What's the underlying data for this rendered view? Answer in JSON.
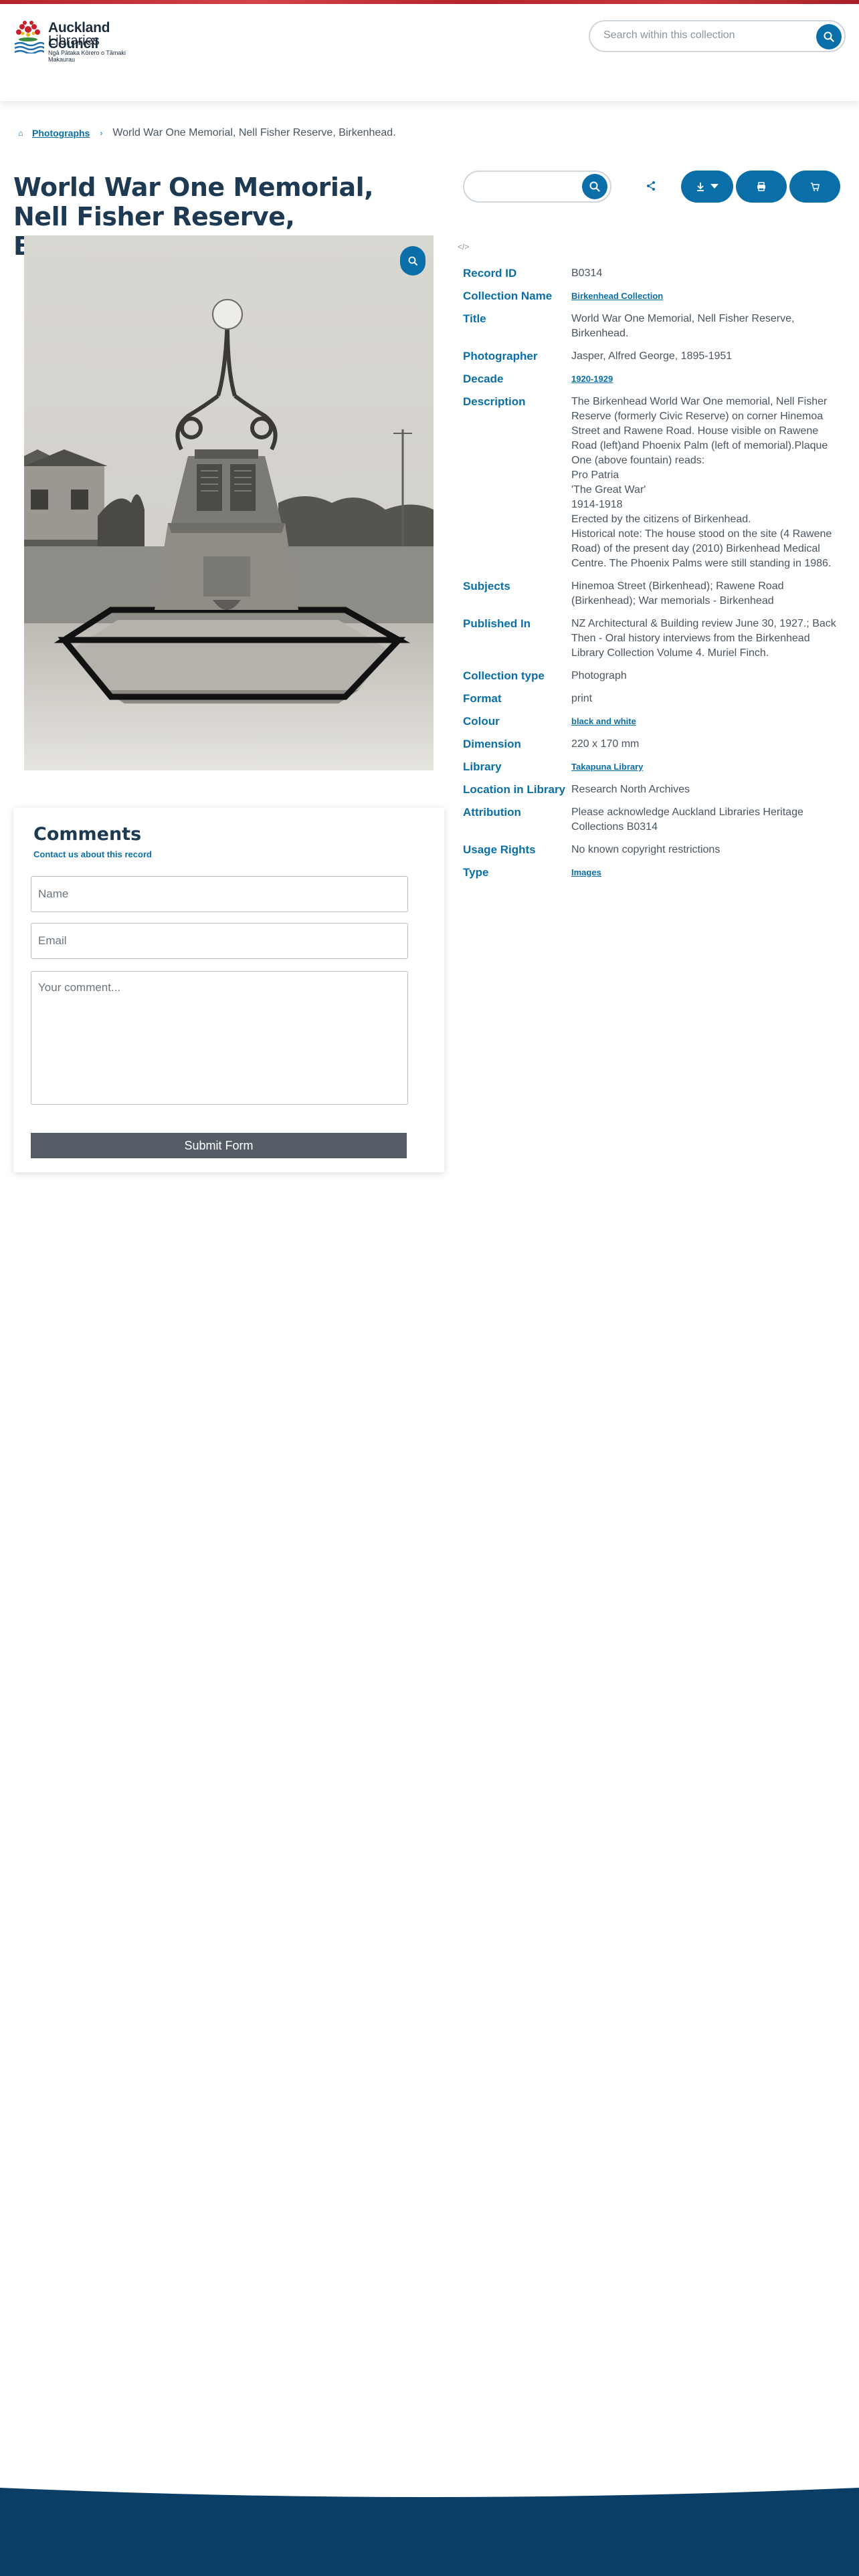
{
  "header": {
    "logo": {
      "line1": "Auckland Council",
      "line2": "Libraries",
      "line3": "Ngā Pātaka Kōrero o Tāmaki Makaurau"
    },
    "search_placeholder": "Search within this collection"
  },
  "breadcrumb": {
    "items": [
      {
        "label": "Photographs"
      },
      {
        "label": "World War One Memorial, Nell Fisher Reserve, Birkenhead."
      }
    ]
  },
  "page_title": "World War One Memorial, Nell Fisher Reserve, Birkenhead.",
  "photo": {
    "alt": "World War One Memorial, Nell Fisher Reserve, Birkenhead."
  },
  "comments": {
    "title": "Comments",
    "contact_link": "Contact us about this record",
    "name_placeholder": "Name",
    "email_placeholder": "Email",
    "comment_placeholder": "Your comment...",
    "submit_label": "Submit Form"
  },
  "record_search": {
    "placeholder": ""
  },
  "toolbar": {
    "icons": [
      "share-icon",
      "download-icon",
      "print-icon",
      "cart-icon"
    ]
  },
  "colors": {
    "accent": "#0a6fa8",
    "title": "#1d3a52",
    "footer": "#0b3e66",
    "brand_red": "#b3232c"
  },
  "details": [
    {
      "label": "Record ID",
      "value": "B0314",
      "link": false
    },
    {
      "label": "Collection Name",
      "value": "Birkenhead Collection",
      "link": true
    },
    {
      "label": "Title",
      "value": "World War One Memorial, Nell Fisher Reserve, Birkenhead.",
      "link": false
    },
    {
      "label": "Photographer",
      "value": "Jasper, Alfred George, 1895-1951",
      "link": false
    },
    {
      "label": "Decade",
      "value": "1920-1929",
      "link": true
    },
    {
      "label": "Description",
      "value": "The Birkenhead World War One memorial, Nell Fisher Reserve (formerly Civic Reserve) on corner Hinemoa Street and Rawene Road. House visible on Rawene Road (left)and Phoenix Palm (left of memorial).Plaque One (above fountain) reads:\nPro Patria\n'The Great War'\n1914-1918\nErected by the citizens of Birkenhead.\nHistorical note: The house stood on the site (4 Rawene Road) of the present day (2010) Birkenhead Medical Centre. The Phoenix Palms were still standing in 1986.",
      "link": false
    },
    {
      "label": "Subjects",
      "value": "Hinemoa Street (Birkenhead); Rawene Road (Birkenhead); War memorials - Birkenhead",
      "link": false
    },
    {
      "label": "Published In",
      "value": "NZ Architectural & Building review June 30, 1927.; Back Then - Oral history interviews from the Birkenhead Library Collection Volume 4. Muriel Finch.",
      "link": false
    },
    {
      "label": "Collection type",
      "value": "Photograph",
      "link": false
    },
    {
      "label": "Format",
      "value": "print",
      "link": false
    },
    {
      "label": "Colour",
      "value": "black and white",
      "link": true
    },
    {
      "label": "Dimension",
      "value": "220 x 170 mm",
      "link": false
    },
    {
      "label": "Library",
      "value": "Takapuna Library",
      "link": true
    },
    {
      "label": "Location in Library",
      "value": "Research North Archives",
      "link": false
    },
    {
      "label": "Attribution",
      "value": "Please acknowledge Auckland Libraries Heritage Collections B0314",
      "link": false
    },
    {
      "label": "Usage Rights",
      "value": "No known copyright restrictions",
      "link": false
    },
    {
      "label": "Type",
      "value": "Images",
      "link": true
    }
  ]
}
